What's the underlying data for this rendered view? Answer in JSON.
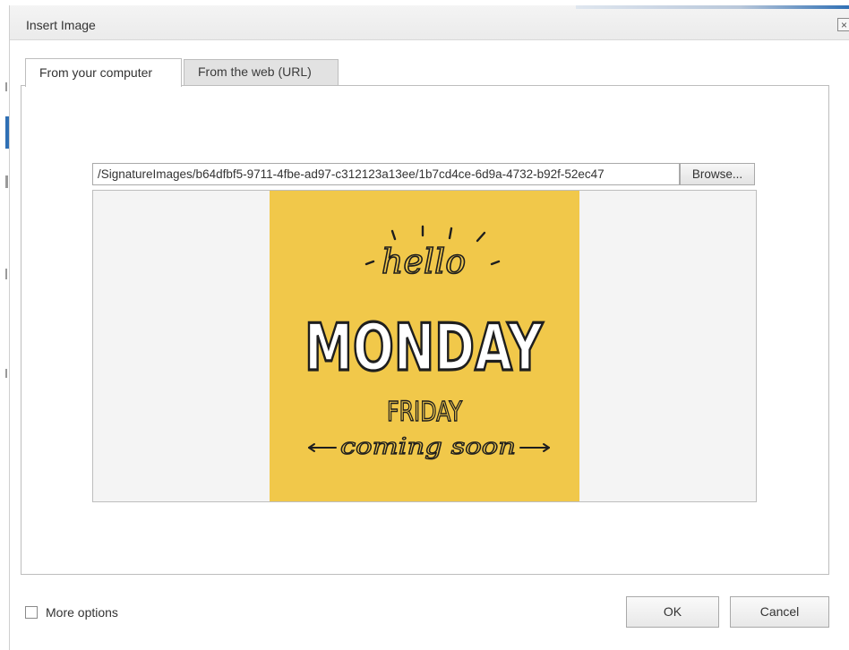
{
  "dialog": {
    "title": "Insert Image",
    "close_glyph": "×"
  },
  "tabs": [
    {
      "label": "From your computer",
      "active": true
    },
    {
      "label": "From the web (URL)",
      "active": false
    }
  ],
  "upload": {
    "path_value": "/SignatureImages/b64dfbf5-9711-4fbe-ad97-c312123a13ee/1b7cd4ce-6d9a-4732-b92f-52ec47",
    "browse_label": "Browse..."
  },
  "preview": {
    "image_text": {
      "hello": "hello",
      "monday": "MONDAY",
      "friday": "FRIDAY",
      "coming_soon": "coming soon"
    },
    "image_background": "#f1c84a"
  },
  "footer": {
    "more_options_label": "More options",
    "more_options_checked": false,
    "ok_label": "OK",
    "cancel_label": "Cancel"
  },
  "colors": {
    "titlebar": "#ebebeb",
    "accent": "#2f6fb4"
  }
}
